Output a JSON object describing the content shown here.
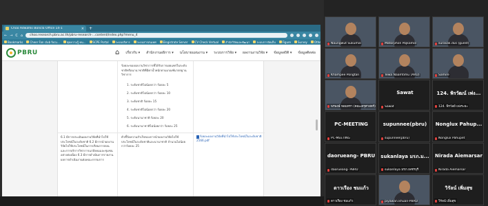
{
  "browser": {
    "tab_title": "Choo Adwahki Boncla Office 14-1",
    "new_tab": "+",
    "url": "choo.research.pbru.ac.th/pbru-research-...content/index.php?menu_4",
    "nav": [
      "←",
      "→",
      "C",
      "⌂"
    ],
    "bookmarks": [
      "Bookmarks",
      "Cheer Fan club focu...",
      "ชุดความรู้ คน...",
      "SCPE Portal",
      "ระบบบริหาร",
      "ระบบสารสนเทศ",
      "Elegistrate Server",
      "CV Check Vertual",
      "สำนักวิจัยและพัฒนา",
      "ระบบการจัดเก็บ",
      "Figure",
      "Survey",
      "Other bookmarks"
    ]
  },
  "site": {
    "logo": "PBRU",
    "home_icon": "home-icon",
    "menu": [
      "เกี่ยวกับ ▾",
      "สำนักงานอธิการ ▾",
      "นโยบายแผนงาน ▾",
      "ระบบการวิจัย ▾",
      "ผลงานงานวิจัย ▾",
      "ข้อมูลสถิติ ▾",
      "ข้อมูลติดต่อ"
    ]
  },
  "doc": {
    "top_text": "ร้อยละของผลงานวิชาการที่ได้รับการเผยแพร่ในระดับชาติหรือนานาชาติที่มีค่าน้ำหนักตามเกณฑ์มาตรฐานวิชาการ",
    "list": [
      "1. ระดับชาติไม่น้อยกว่า ร้อยละ 5",
      "2. ระดับชาติไม่น้อยกว่า ร้อยละ 10",
      "3. ระดับชาติ ร้อยละ 15",
      "4. ระดับชาติไม่น้อยกว่า ร้อยละ 20",
      "5. ระดับนานาชาติ ร้อยละ 20",
      "6. ระดับนานาชาติไม่น้อยกว่า ร้อยละ 25"
    ],
    "left_text": "6.1 มีการประเมินผลงานวิจัยที่นำไปใช้ประโยชน์ในระดับชาติ 6.2 มีการนำผลงานวิจัยไปใช้ประโยชน์ในการเรียนการสอนและการบริการวิชาการแก่สังคมและชุมชนอย่างต่อเนื่อง 6.3 มีการดำเนินการรายงานผลการดำเนินงานต่อคณะกรรมการ",
    "mid_text": "ตัวชี้วัดความสำเร็จของการนำผลงานวิจัยไปใช้ประโยชน์ในระดับชาติและนานาชาติ จำนวนไม่น้อยกว่าร้อยละ 25",
    "file_link": "ร้อยละผลงานวิจัยที่นำไปใช้ประโยชน์ในระดับชาติ 2566.pdf"
  },
  "participants": [
    {
      "name": "Naungwut Sukumal",
      "type": "video",
      "color": "grey"
    },
    {
      "name": "Matorphon Pojkamol",
      "type": "video",
      "color": "blue"
    },
    {
      "name": "surasak.dus (guest)",
      "type": "video",
      "color": "purple"
    },
    {
      "name": "Khampee Pongtan",
      "type": "video",
      "color": "green"
    },
    {
      "name": "Tewa Naamtimu (ARU)",
      "type": "video",
      "color": "grey"
    },
    {
      "name": "Samire",
      "type": "video",
      "color": "tan"
    },
    {
      "name": "พรพงษ์ หอมทรา (คณะครุศาสตร์)",
      "type": "video",
      "color": "teal"
    },
    {
      "name": "Sawat",
      "big": "Sawat",
      "type": "name"
    },
    {
      "name": "124. พิรวัลย์ เพ่งระยะ",
      "big": "124. พิรวัฒน์ เพ่ง...",
      "type": "name"
    },
    {
      "name": "PC-MEETING",
      "big": "PC-MEETING",
      "type": "name"
    },
    {
      "name": "supunnee(pbru)",
      "big": "supunnee(pbru)",
      "type": "name"
    },
    {
      "name": "Nonglux Pahupet",
      "big": "Nonglux Pahup...",
      "type": "name"
    },
    {
      "name": "daorueang- PBRU",
      "big": "daorueang- PBRU",
      "type": "name"
    },
    {
      "name": "sukanlaya มรภ.เพชรบุรี",
      "big": "sukanlaya มรภ.ม...",
      "type": "name"
    },
    {
      "name": "Nirada Aiemarsar",
      "big": "Nirada Aiemarsar",
      "type": "name"
    },
    {
      "name": "ดาวเรือง ชมแก้ว",
      "big": "ดาวเรือง ชมแก้ว",
      "type": "name"
    },
    {
      "name": "piyawan.khuan-PBRU",
      "type": "video",
      "color": "tan"
    },
    {
      "name": "วิรัลน์ เพิ่มสุข",
      "big": "วิรัลน์ เพิ่มสุข",
      "type": "name"
    }
  ]
}
